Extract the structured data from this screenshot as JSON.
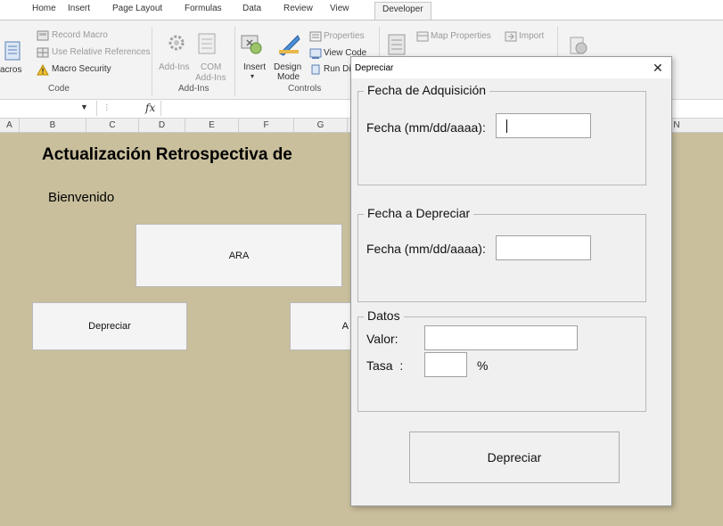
{
  "ribbon": {
    "tabs": [
      "Home",
      "Insert",
      "Page Layout",
      "Formulas",
      "Data",
      "Review",
      "View",
      "Developer"
    ],
    "active_tab": "Developer",
    "code": {
      "macros_label": "acros",
      "record_macro": "Record Macro",
      "relative_refs": "Use Relative References",
      "macro_security": "Macro Security",
      "group": "Code"
    },
    "addins": {
      "addins_label": "Add-Ins",
      "com_label_1": "COM",
      "com_label_2": "Add-Ins",
      "group": "Add-Ins"
    },
    "controls": {
      "insert_label": "Insert",
      "design_label_1": "Design",
      "design_label_2": "Mode",
      "properties": "Properties",
      "view_code": "View Code",
      "run_dialog": "Run Di",
      "group": "Controls"
    },
    "xml": {
      "map_properties": "Map Properties",
      "import": "Import"
    }
  },
  "formula_bar": {
    "fx": "fx"
  },
  "columns": [
    "A",
    "B",
    "C",
    "D",
    "E",
    "F",
    "G",
    "N"
  ],
  "sheet": {
    "title": "Actualización Retrospectiva de",
    "welcome": "Bienvenido",
    "btn_ara": "ARA",
    "btn_depreciar": "Depreciar",
    "btn_partial": "A"
  },
  "dialog": {
    "title": "Depreciar",
    "close_glyph": "✕",
    "frame1": {
      "legend": "Fecha de Adquisición",
      "label": "Fecha (mm/dd/aaaa):",
      "value": ""
    },
    "frame2": {
      "legend": "Fecha a Depreciar",
      "label": "Fecha (mm/dd/aaaa):",
      "value": ""
    },
    "frame3": {
      "legend": "Datos",
      "valor_label": "Valor:",
      "valor_value": "",
      "tasa_label": "Tasa  :",
      "tasa_value": "",
      "percent": "%"
    },
    "submit_label": "Depreciar"
  }
}
